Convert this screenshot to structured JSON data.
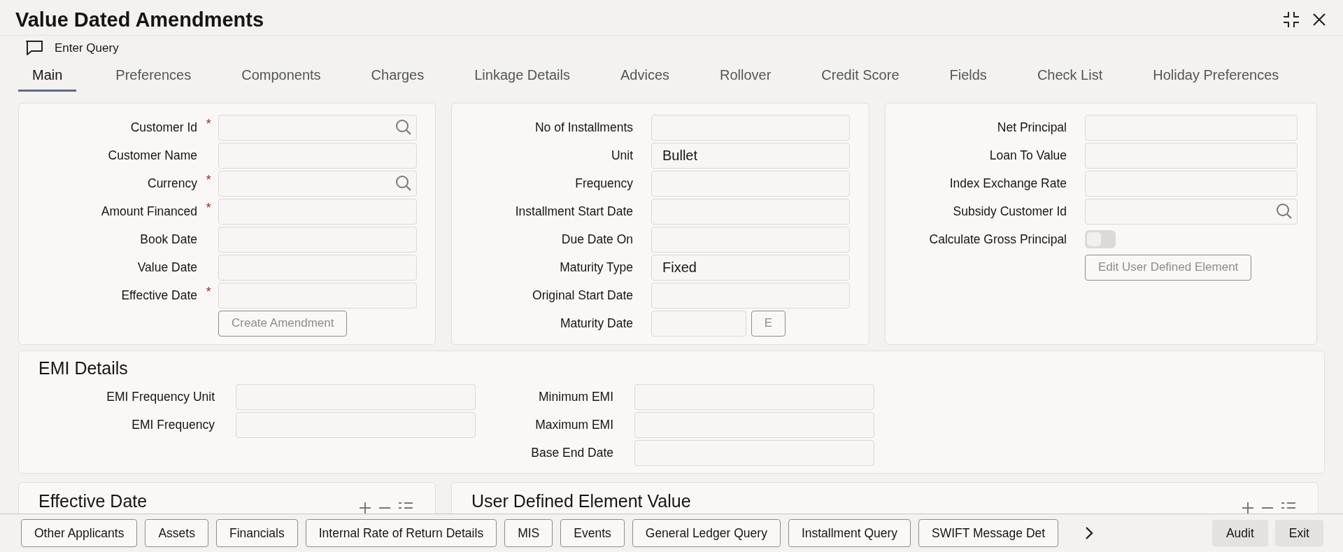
{
  "window": {
    "title": "Value Dated Amendments"
  },
  "toolbar": {
    "enter_query": "Enter Query"
  },
  "tabs": [
    {
      "label": "Main",
      "selected": true
    },
    {
      "label": "Preferences",
      "selected": false
    },
    {
      "label": "Components",
      "selected": false
    },
    {
      "label": "Charges",
      "selected": false
    },
    {
      "label": "Linkage Details",
      "selected": false
    },
    {
      "label": "Advices",
      "selected": false
    },
    {
      "label": "Rollover",
      "selected": false
    },
    {
      "label": "Credit Score",
      "selected": false
    },
    {
      "label": "Fields",
      "selected": false
    },
    {
      "label": "Check List",
      "selected": false
    },
    {
      "label": "Holiday Preferences",
      "selected": false
    }
  ],
  "panels": [
    {
      "fields": [
        {
          "kind": "search",
          "label": "Customer Id",
          "required_mark": "*"
        },
        {
          "kind": "text",
          "label": "Customer Name"
        },
        {
          "kind": "search",
          "label": "Currency",
          "required_mark": "*"
        },
        {
          "kind": "text",
          "label": "Amount Financed",
          "required_mark": "*"
        },
        {
          "kind": "text",
          "label": "Book Date"
        },
        {
          "kind": "text",
          "label": "Value Date"
        },
        {
          "kind": "text",
          "label": "Effective Date",
          "required_mark": "*"
        }
      ],
      "button": {
        "label": "Create Amendment",
        "disabled": true
      }
    },
    {
      "fields": [
        {
          "kind": "text",
          "label": "No of Installments"
        },
        {
          "kind": "text",
          "label": "Unit",
          "value": "Bullet"
        },
        {
          "kind": "text",
          "label": "Frequency"
        },
        {
          "kind": "text",
          "label": "Installment Start Date"
        },
        {
          "kind": "text",
          "label": "Due Date On"
        },
        {
          "kind": "text",
          "label": "Maturity Type",
          "value": "Fixed"
        },
        {
          "kind": "text",
          "label": "Original Start Date"
        },
        {
          "kind": "short_with_button",
          "label": "Maturity Date",
          "button": "E"
        }
      ]
    },
    {
      "fields": [
        {
          "kind": "text",
          "label": "Net Principal"
        },
        {
          "kind": "text",
          "label": "Loan To Value"
        },
        {
          "kind": "text",
          "label": "Index Exchange Rate"
        },
        {
          "kind": "search",
          "label": "Subsidy Customer Id"
        },
        {
          "kind": "toggle",
          "label": "Calculate Gross Principal",
          "on": false
        }
      ],
      "button": {
        "label": "Edit User Defined Element",
        "disabled": true
      }
    }
  ],
  "emi_details": {
    "title": "EMI Details",
    "left_fields": [
      {
        "label": "EMI Frequency Unit"
      },
      {
        "label": "EMI Frequency"
      }
    ],
    "right_fields": [
      {
        "label": "Minimum EMI"
      },
      {
        "label": "Maximum EMI"
      },
      {
        "label": "Base End Date"
      }
    ]
  },
  "lower_sections": [
    {
      "title": "Effective Date"
    },
    {
      "title": "User Defined Element Value"
    }
  ],
  "footer": {
    "buttons": [
      "Other Applicants",
      "Assets",
      "Financials",
      "Internal Rate of Return Details",
      "MIS",
      "Events",
      "General Ledger Query",
      "Installment Query",
      "SWIFT Message Det"
    ],
    "actions": [
      "Audit",
      "Exit"
    ]
  }
}
